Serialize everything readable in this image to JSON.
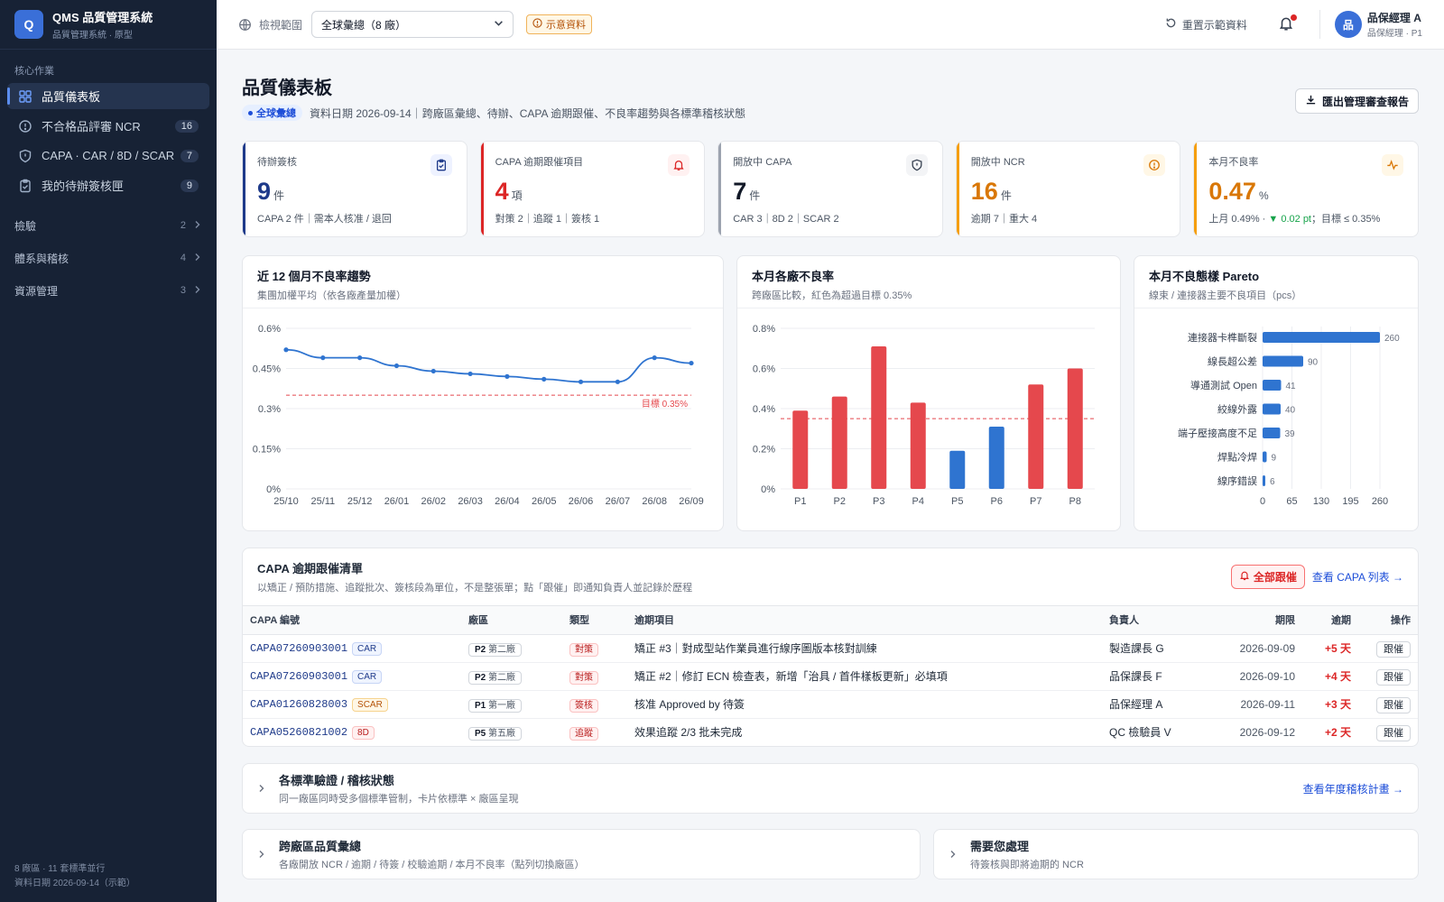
{
  "app": {
    "logo": "Q",
    "title": "QMS 品質管理系統",
    "subtitle": "品質管理系統 · 原型"
  },
  "sidebar": {
    "section_label": "核心作業",
    "items": [
      {
        "label": "品質儀表板",
        "count": "",
        "icon": "dashboard-icon"
      },
      {
        "label": "不合格品評審 NCR",
        "count": "16",
        "icon": "alert-circle-icon"
      },
      {
        "label": "CAPA · CAR / 8D / SCAR",
        "count": "7",
        "icon": "shield-icon"
      },
      {
        "label": "我的待辦簽核匣",
        "count": "9",
        "icon": "clipboard-icon"
      }
    ],
    "groups": [
      {
        "label": "檢驗",
        "count": "2"
      },
      {
        "label": "體系與稽核",
        "count": "4"
      },
      {
        "label": "資源管理",
        "count": "3"
      }
    ],
    "footer_line1": "8 廠區 · 11 套標準並行",
    "footer_line2": "資料日期 2026-09-14（示範）"
  },
  "topbar": {
    "scope_label": "檢視範圍",
    "scope_value": "全球彙總（8 廠）",
    "demo_badge": "示意資料",
    "reset_label": "重置示範資料",
    "user_avatar": "品",
    "user_name": "品保經理 A",
    "user_role": "品保經理 · P1"
  },
  "header": {
    "title": "品質儀表板",
    "scope_pill": "全球彙總",
    "subtitle": "資料日期 2026-09-14｜跨廠區彙總、待辦、CAPA 逾期跟催、不良率趨勢與各標準稽核狀態",
    "export_label": "匯出管理審查報告"
  },
  "kpis": [
    {
      "label": "待辦簽核",
      "value": "9",
      "unit": "件",
      "sub": "CAPA 2 件｜需本人核准 / 退回",
      "color": "#1e3a8a",
      "icon": "clipboard-check-icon"
    },
    {
      "label": "CAPA 逾期跟催項目",
      "value": "4",
      "unit": "項",
      "sub": "對策 2｜追蹤 1｜簽核 1",
      "color": "#dc2626",
      "icon": "bell-icon"
    },
    {
      "label": "開放中 CAPA",
      "value": "7",
      "unit": "件",
      "sub": "CAR 3｜8D 2｜SCAR 2",
      "color": "#111827",
      "icon": "shield-icon"
    },
    {
      "label": "開放中 NCR",
      "value": "16",
      "unit": "件",
      "sub": "逾期 7｜重大 4",
      "color": "#d97706",
      "icon": "alert-circle-icon"
    },
    {
      "label": "本月不良率",
      "value": "0.47",
      "unit": "%",
      "sub_pre": "上月 0.49% ·",
      "sub_delta": "▼ 0.02 pt",
      "sub_post": "；目標 ≤ 0.35%",
      "color": "#d97706",
      "icon": "activity-icon"
    }
  ],
  "charts": {
    "trend": {
      "title": "近 12 個月不良率趨勢",
      "subtitle": "集團加權平均（依各廠產量加權）"
    },
    "plants": {
      "title": "本月各廠不良率",
      "subtitle": "跨廠區比較，紅色為超過目標 0.35%"
    },
    "pareto": {
      "title": "本月不良態樣 Pareto",
      "subtitle": "線束 / 連接器主要不良項目（pcs）"
    }
  },
  "chart_data": [
    {
      "type": "line",
      "x": [
        "25/10",
        "25/11",
        "25/12",
        "26/01",
        "26/02",
        "26/03",
        "26/04",
        "26/05",
        "26/06",
        "26/07",
        "26/08",
        "26/09"
      ],
      "series": [
        {
          "values": [
            0.52,
            0.49,
            0.49,
            0.46,
            0.44,
            0.43,
            0.42,
            0.41,
            0.4,
            0.4,
            0.49,
            0.47
          ]
        }
      ],
      "ylim": [
        0,
        0.6
      ],
      "yticks": [
        "0%",
        "0.15%",
        "0.3%",
        "0.45%",
        "0.6%"
      ],
      "target": 0.35,
      "target_label": "目標 0.35%"
    },
    {
      "type": "bar",
      "categories": [
        "P1",
        "P2",
        "P3",
        "P4",
        "P5",
        "P6",
        "P7",
        "P8"
      ],
      "values": [
        0.39,
        0.46,
        0.71,
        0.43,
        0.19,
        0.31,
        0.52,
        0.6
      ],
      "ylim": [
        0,
        0.8
      ],
      "yticks": [
        "0%",
        "0.2%",
        "0.4%",
        "0.6%",
        "0.8%"
      ],
      "target": 0.35,
      "over_color": "#e5484d",
      "ok_color": "#2f74d0"
    },
    {
      "type": "bar",
      "orientation": "horizontal",
      "categories": [
        "連接器卡榫斷裂",
        "線長超公差",
        "導通測試 Open",
        "絞線外露",
        "端子壓接高度不足",
        "焊點冷焊",
        "線序錯誤"
      ],
      "values": [
        260,
        90,
        41,
        40,
        39,
        9,
        6
      ],
      "xlim": [
        0,
        260
      ],
      "xticks": [
        "0",
        "65",
        "130",
        "195",
        "260"
      ]
    }
  ],
  "capa": {
    "title": "CAPA 逾期跟催清單",
    "subtitle": "以矯正 / 預防措施、追蹤批次、簽核段為單位，不是整張單；點「跟催」即通知負責人並記錄於歷程",
    "remind_all": "全部跟催",
    "view_list": "查看 CAPA 列表 →",
    "columns": [
      "CAPA 編號",
      "廠區",
      "類型",
      "逾期項目",
      "負責人",
      "期限",
      "逾期",
      "操作"
    ],
    "rows": [
      {
        "id": "CAPA07260903001",
        "kind": "CAR",
        "kc": "car",
        "plant_code": "P2",
        "plant": "第二廠",
        "type": "對策",
        "item": "矯正 #3｜對成型站作業員進行線序圖版本核對訓練",
        "owner": "製造課長 G",
        "due": "2026-09-09",
        "over": "+5 天",
        "action": "跟催"
      },
      {
        "id": "CAPA07260903001",
        "kind": "CAR",
        "kc": "car",
        "plant_code": "P2",
        "plant": "第二廠",
        "type": "對策",
        "item": "矯正 #2｜修訂 ECN 檢查表，新增「治具 / 首件樣板更新」必填項",
        "owner": "品保課長 F",
        "due": "2026-09-10",
        "over": "+4 天",
        "action": "跟催"
      },
      {
        "id": "CAPA01260828003",
        "kind": "SCAR",
        "kc": "scar",
        "plant_code": "P1",
        "plant": "第一廠",
        "type": "簽核",
        "item": "核准 Approved by 待簽",
        "owner": "品保經理 A",
        "due": "2026-09-11",
        "over": "+3 天",
        "action": "跟催"
      },
      {
        "id": "CAPA05260821002",
        "kind": "8D",
        "kc": "d8",
        "plant_code": "P5",
        "plant": "第五廠",
        "type": "追蹤",
        "item": "效果追蹤 2/3 批未完成",
        "owner": "QC 檢驗員 V",
        "due": "2026-09-12",
        "over": "+2 天",
        "action": "跟催"
      }
    ]
  },
  "sections": {
    "audit": {
      "title": "各標準驗證 / 稽核狀態",
      "subtitle": "同一廠區同時受多個標準管制，卡片依標準 × 廠區呈現",
      "link": "查看年度稽核計畫 →"
    },
    "cross": {
      "title": "跨廠區品質彙總",
      "subtitle": "各廠開放 NCR / 逾期 / 待簽 / 校驗逾期 / 本月不良率（點列切換廠區）"
    },
    "todo": {
      "title": "需要您處理",
      "subtitle": "待簽核與即將逾期的 NCR"
    }
  }
}
